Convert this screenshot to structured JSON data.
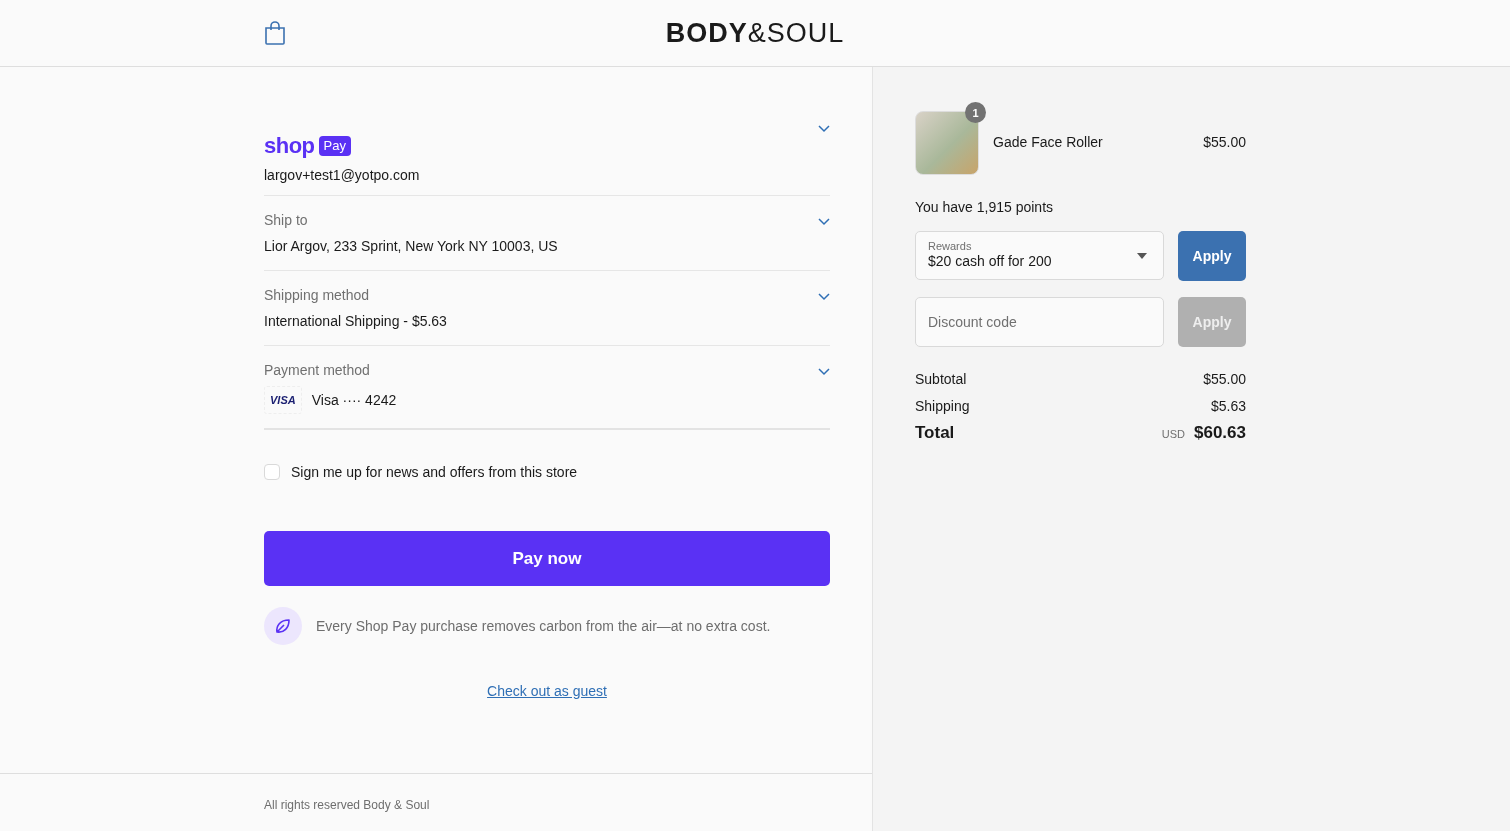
{
  "header": {
    "logo": "**BODY**&SOUL"
  },
  "shop_pay": {
    "wordmark": "shop",
    "badge": "Pay",
    "email": "largov+test1@yotpo.com",
    "expanded": false
  },
  "sections": [
    {
      "kind": "address",
      "label": "Ship to",
      "value": "Lior Argov, 233 Sprint, New York NY 10003, US",
      "expanded": false
    },
    {
      "kind": "shipping",
      "label": "Shipping method",
      "value": "International Shipping - $5.63",
      "expanded": false
    },
    {
      "kind": "payment",
      "label": "Payment method",
      "card_brand": "VISA",
      "value": "Visa ···· 4242",
      "expanded": false
    }
  ],
  "newsletter": {
    "label": "Sign me up for news and offers from this store",
    "checked": false
  },
  "pay_button": "Pay now",
  "carbon_note": "Every Shop Pay purchase removes carbon from the air—at no extra cost.",
  "guest_link": "Check out as guest",
  "footer": "All rights reserved Body & Soul",
  "order": {
    "items": [
      {
        "name": "Gade Face Roller",
        "quantity": "1",
        "price": "$55.00"
      }
    ],
    "points": "You have 1,915 points",
    "rewards": {
      "label": "Rewards",
      "value": "$20 cash off for 200",
      "button": "Apply",
      "disabled": false
    },
    "discount": {
      "placeholder": "Discount code",
      "button": "Apply",
      "disabled": true
    },
    "lines": [
      {
        "label": "Subtotal",
        "value": "$55.00"
      },
      {
        "label": "Shipping",
        "value": "$5.63"
      }
    ],
    "total": {
      "label": "Total",
      "currency": "USD",
      "value": "$60.63"
    }
  }
}
